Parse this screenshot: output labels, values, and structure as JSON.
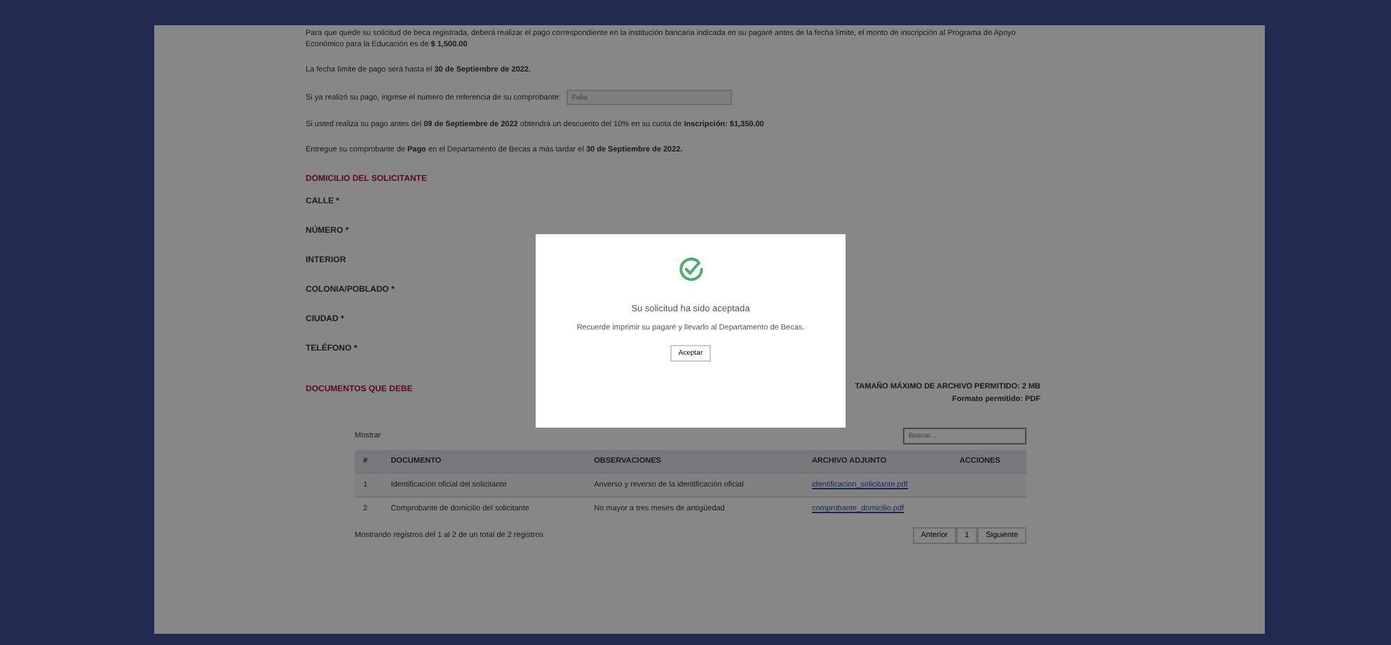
{
  "intro": [
    {
      "text": "Para que quede su solicitud de beca registrada, deberá realizar el pago correspondiente en la institución bancaria indicada en su pagaré antes de la fecha límite, el monto de inscripción al Programa de Apoyo Económico para la Educación es de **$ 1,500.00**"
    },
    {
      "text": "La fecha límite de pago será hasta el **30 de Septiembre de 2022.**"
    },
    {
      "text": "Si ya realizó su pago, ingrese el número de referencia de su comprobante:",
      "field": {
        "placeholder": "Folio"
      }
    },
    {
      "text": "Si usted realiza su pago antes del **09 de Septiembre de 2022** obtendrá un descuento del 10% en su cuota de **Inscripción: $1,350.00**"
    },
    {
      "text": "Entregue su comprobante de **Pago** en el Departamento de Becas a más tardar el **30 de Septiembre de 2022.**"
    }
  ],
  "address": {
    "title": "DOMICILIO DEL SOLICITANTE",
    "fields": [
      "CALLE *",
      "NÚMERO *",
      "INTERIOR",
      "COLONIA/POBLADO *",
      "CIUDAD *",
      "TELÉFONO *"
    ]
  },
  "documents": {
    "title": "DOCUMENTOS QUE DEBE",
    "note": "TAMAÑO MÁXIMO DE ARCHIVO PERMITIDO: 2 MB",
    "note2": "Formato permitido: PDF",
    "show_label": "Mostrar",
    "search": {
      "placeholder": "Buscar..."
    },
    "columns": [
      "#",
      "DOCUMENTO",
      "OBSERVACIONES",
      "ARCHIVO ADJUNTO",
      "ACCIONES"
    ],
    "rows": [
      {
        "num": "1",
        "document": "Identificación oficial del solicitante",
        "notes": "Anverso y reverso de la identificación oficial",
        "file": "identificacion_solicitante.pdf"
      },
      {
        "num": "2",
        "document": "Comprobante de domicilio del solicitante",
        "notes": "No mayor a tres meses de antigüedad",
        "file": "comprobante_domicilio.pdf"
      }
    ],
    "footer": "Mostrando registros del 1 al 2 de un total de 2 registros",
    "pager": {
      "previous": "Anterior",
      "page": "1",
      "next": "Siguiente"
    }
  },
  "modal": {
    "title": "Su solicitud ha sido aceptada",
    "message": "Recuerde imprimir su pagaré y llevarlo al Departamento de Becas.",
    "button": "Aceptar"
  }
}
